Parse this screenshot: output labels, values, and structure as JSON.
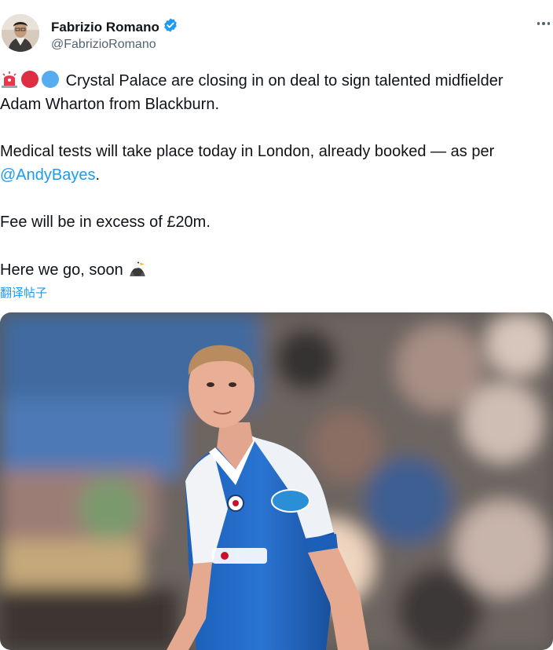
{
  "author": {
    "name": "Fabrizio Romano",
    "handle": "@FabrizioRomano",
    "verified": true
  },
  "tweet": {
    "line1_text": "Crystal Palace are closing in on deal to sign talented midfielder",
    "line2_text": "Adam Wharton from Blackburn.",
    "line3_text": "Medical tests will take place today in London, already booked — as per",
    "mention": "@AndyBayes",
    "after_mention": ".",
    "line5_text": "Fee will be in excess of £20m.",
    "line6_text": "Here we go, soon",
    "emojis": [
      "siren-icon",
      "red-circle-icon",
      "blue-circle-icon",
      "eagle-icon"
    ]
  },
  "translate_label": "翻译帖子",
  "colors": {
    "link": "#1d9bf0",
    "verified": "#1d9bf0",
    "text": "#0f1419",
    "secondary": "#536471"
  }
}
